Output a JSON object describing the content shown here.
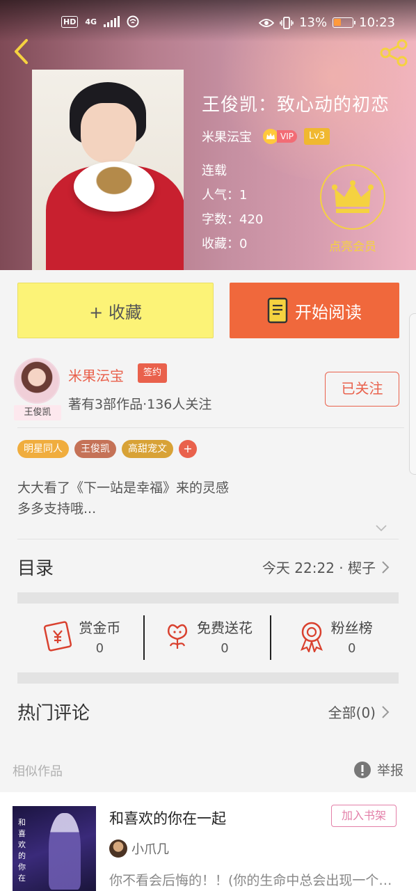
{
  "statusbar": {
    "network": "HD",
    "signal": "4G",
    "battery": "13%",
    "time": "10:23"
  },
  "book": {
    "title": "王俊凯：致心动的初恋",
    "author": "米果沄宝",
    "vip": "VIP",
    "level": "Lv3",
    "status": "连载",
    "popularity": "人气：1",
    "word_count": "字数：420",
    "favorites": "收藏：0",
    "member_label": "点亮会员"
  },
  "actions_main": {
    "favorite": "+ 收藏",
    "read": "开始阅读"
  },
  "author_card": {
    "avatar_tag": "王俊凯",
    "name": "米果沄宝",
    "sign_badge": "签约",
    "meta": "著有3部作品·136人关注",
    "follow": "已关注"
  },
  "tags": [
    {
      "label": "明星同人",
      "color": "#f0ad3e"
    },
    {
      "label": "王俊凯",
      "color": "#c57257"
    },
    {
      "label": "高甜宠文",
      "color": "#d8a236"
    }
  ],
  "tag_plus": "+",
  "intro": {
    "line1": "大大看了《下一站是幸福》来的灵感",
    "line2": "多多支持哦..."
  },
  "toc": {
    "label": "目录",
    "latest": "今天 22:22 · 楔子"
  },
  "rewards": [
    {
      "label": "赏金币",
      "value": "0",
      "icon": "coin-envelope-icon"
    },
    {
      "label": "免费送花",
      "value": "0",
      "icon": "flower-icon"
    },
    {
      "label": "粉丝榜",
      "value": "0",
      "icon": "ribbon-award-icon"
    }
  ],
  "hot_comments": {
    "label": "热门评论",
    "all": "全部(0)"
  },
  "similar": {
    "label": "相似作品",
    "report": "举报"
  },
  "similar_book": {
    "title": "和喜欢的你在一起",
    "add": "加入书架",
    "author": "小爪几",
    "desc": "你不看会后悔的！！(你的生命中总会出现一个人，他会让你明白...",
    "cover_text": "和喜欢的你在"
  }
}
